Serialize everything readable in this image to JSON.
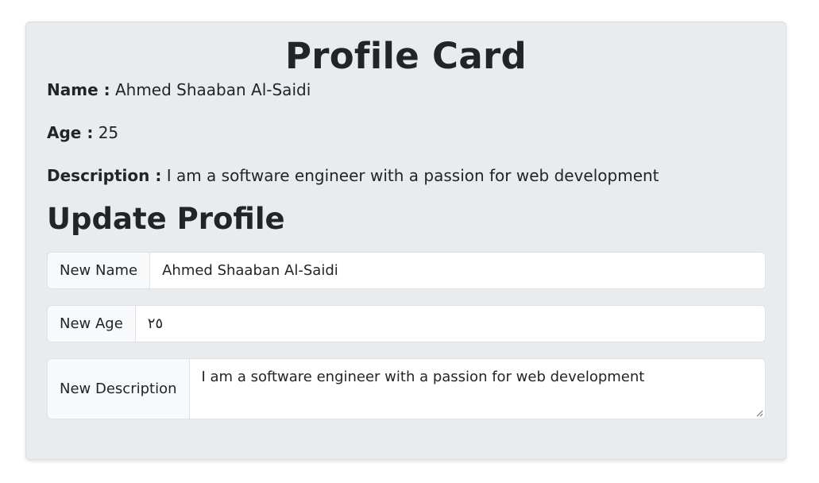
{
  "card": {
    "title": "Profile Card",
    "name_label": "Name :",
    "name_value": "Ahmed Shaaban Al-Saidi",
    "age_label": "Age :",
    "age_value": "25",
    "description_label": "Description :",
    "description_value": "I am a software engineer with a passion for web development"
  },
  "update": {
    "title": "Update Profile",
    "name_field": {
      "label": "New Name",
      "value": "Ahmed Shaaban Al-Saidi"
    },
    "age_field": {
      "label": "New Age",
      "value": "٢٥"
    },
    "description_field": {
      "label": "New Description",
      "value": "I am a software engineer with a passion for web development"
    }
  },
  "colors": {
    "card_background": "#e9ecef",
    "input_background": "#ffffff",
    "addon_background": "#f8f9fa",
    "border": "#dee2e6",
    "text": "#212529"
  }
}
